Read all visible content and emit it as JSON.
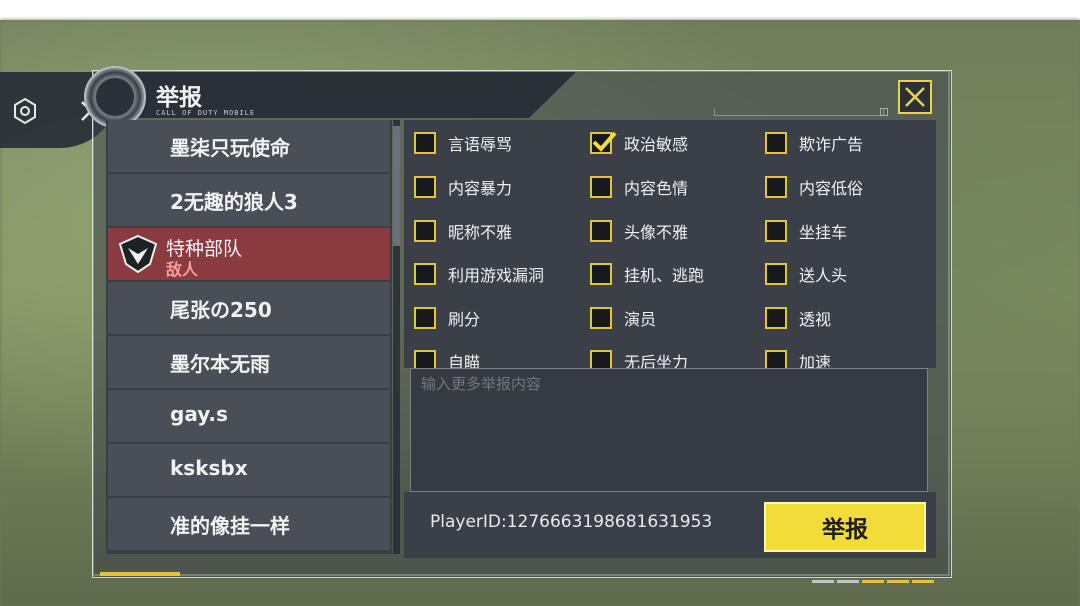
{
  "dialog": {
    "title": "举报",
    "subtitle": "CALL OF DUTY MOBILE"
  },
  "players": [
    {
      "name": "墨柒只玩使命"
    },
    {
      "name": "2无趣的狼人3"
    },
    {
      "name": "特种部队",
      "tag": "敌人",
      "selected": true
    },
    {
      "name": "尾张の250"
    },
    {
      "name": "墨尔本无雨"
    },
    {
      "name": "gay.s"
    },
    {
      "name": "ksksbx"
    },
    {
      "name": "准的像挂一样"
    }
  ],
  "reasons": [
    {
      "label": "言语辱骂",
      "checked": false
    },
    {
      "label": "政治敏感",
      "checked": true
    },
    {
      "label": "欺诈广告",
      "checked": false
    },
    {
      "label": "内容暴力",
      "checked": false
    },
    {
      "label": "内容色情",
      "checked": false
    },
    {
      "label": "内容低俗",
      "checked": false
    },
    {
      "label": "昵称不雅",
      "checked": false
    },
    {
      "label": "头像不雅",
      "checked": false
    },
    {
      "label": "坐挂车",
      "checked": false
    },
    {
      "label": "利用游戏漏洞",
      "checked": false
    },
    {
      "label": "挂机、逃跑",
      "checked": false
    },
    {
      "label": "送人头",
      "checked": false
    },
    {
      "label": "刷分",
      "checked": false
    },
    {
      "label": "演员",
      "checked": false
    },
    {
      "label": "透视",
      "checked": false
    },
    {
      "label": "自瞄",
      "checked": false
    },
    {
      "label": "无后坐力",
      "checked": false
    },
    {
      "label": "加速",
      "checked": false
    }
  ],
  "more_input": {
    "placeholder": "输入更多举报内容"
  },
  "player_id": "PlayerID:1276663198681631953",
  "report_button": "举报",
  "colors": {
    "accent": "#f2dc3a",
    "selected_row": "#8a3b3f",
    "enemy_tag": "#ff9a9a"
  }
}
